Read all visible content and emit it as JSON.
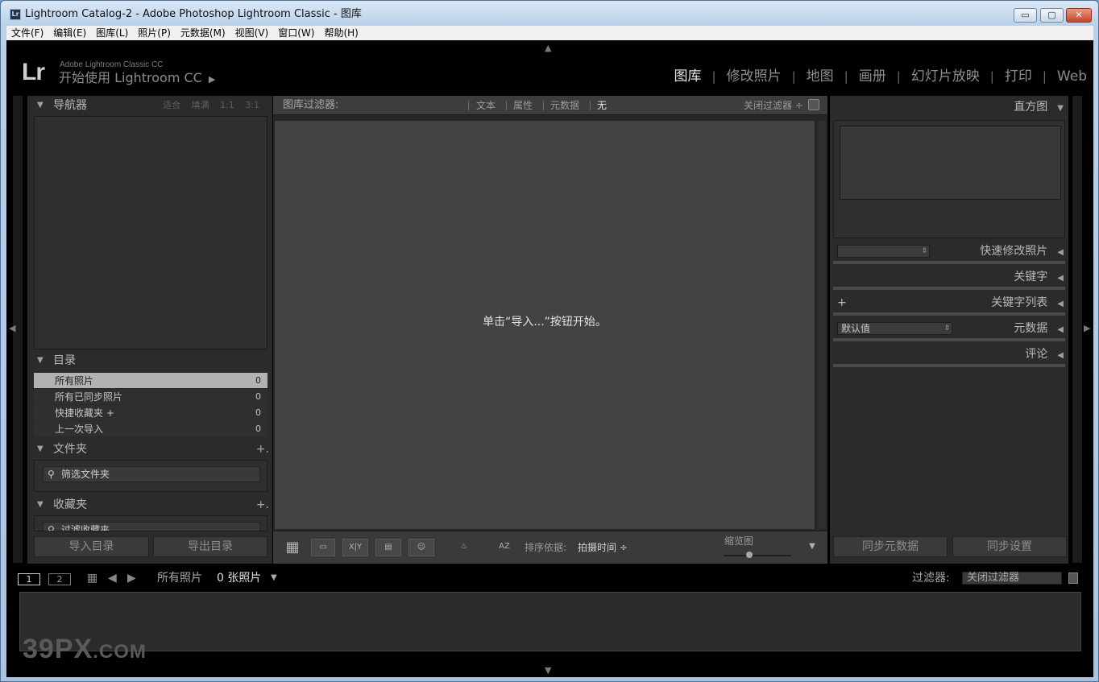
{
  "window": {
    "title": "Lightroom Catalog-2 - Adobe Photoshop Lightroom Classic - 图库",
    "app_icon": "Lr",
    "min": "▭",
    "max": "▢",
    "close": "✕"
  },
  "menu": [
    "文件(F)",
    "编辑(E)",
    "图库(L)",
    "照片(P)",
    "元数据(M)",
    "视图(V)",
    "窗口(W)",
    "帮助(H)"
  ],
  "identity": {
    "logo": "Lr",
    "small": "Adobe Lightroom Classic CC",
    "big": "开始使用 Lightroom CC",
    "arrow": "▶"
  },
  "modules": [
    "图库",
    "修改照片",
    "地图",
    "画册",
    "幻灯片放映",
    "打印",
    "Web"
  ],
  "module_sep": "|",
  "left": {
    "navigator": {
      "title": "导航器",
      "options": [
        "适合",
        "填满",
        "1:1",
        "3:1"
      ]
    },
    "catalog": {
      "title": "目录",
      "rows": [
        {
          "label": "所有照片",
          "count": "0"
        },
        {
          "label": "所有已同步照片",
          "count": "0"
        },
        {
          "label": "快捷收藏夹 +",
          "count": "0"
        },
        {
          "label": "上一次导入",
          "count": "0"
        }
      ]
    },
    "folders": {
      "title": "文件夹",
      "plus": "+.",
      "search": "筛选文件夹"
    },
    "collections": {
      "title": "收藏夹",
      "plus": "+.",
      "search": "过滤收藏夹"
    },
    "import_btn": "导入目录",
    "export_btn": "导出目录"
  },
  "filter_bar": {
    "label": "图库过滤器:",
    "opts": [
      "文本",
      "属性",
      "元数据",
      "无"
    ],
    "off": "关闭过滤器 ÷"
  },
  "center": {
    "message": "单击“导入...”按钮开始。"
  },
  "toolbar": {
    "grid": "▦",
    "loupe": "▭",
    "compare": "X|Y",
    "survey": "▤",
    "people": "☺",
    "spray": "♨",
    "sort_icon": "AZ",
    "sort_label": "排序依据:",
    "sort_value": "拍摄时间 ÷",
    "thumb_label": "缩览图",
    "menu": "▼"
  },
  "right": {
    "histogram": "直方图",
    "quick": "快速修改照片",
    "keywording": "关键字",
    "kw_list": "关键字列表",
    "kw_plus": "+",
    "metadata": "元数据",
    "metadata_select": "默认值",
    "comments": "评论",
    "sync_meta": "同步元数据",
    "sync_set": "同步设置"
  },
  "bottom": {
    "screen1": "1",
    "screen2": "2",
    "source": "所有照片",
    "count": "0 张照片",
    "filter_label": "过滤器:",
    "filter_value": "关闭过滤器"
  },
  "watermark": {
    "main": "39PX",
    "suffix": ".COM"
  }
}
